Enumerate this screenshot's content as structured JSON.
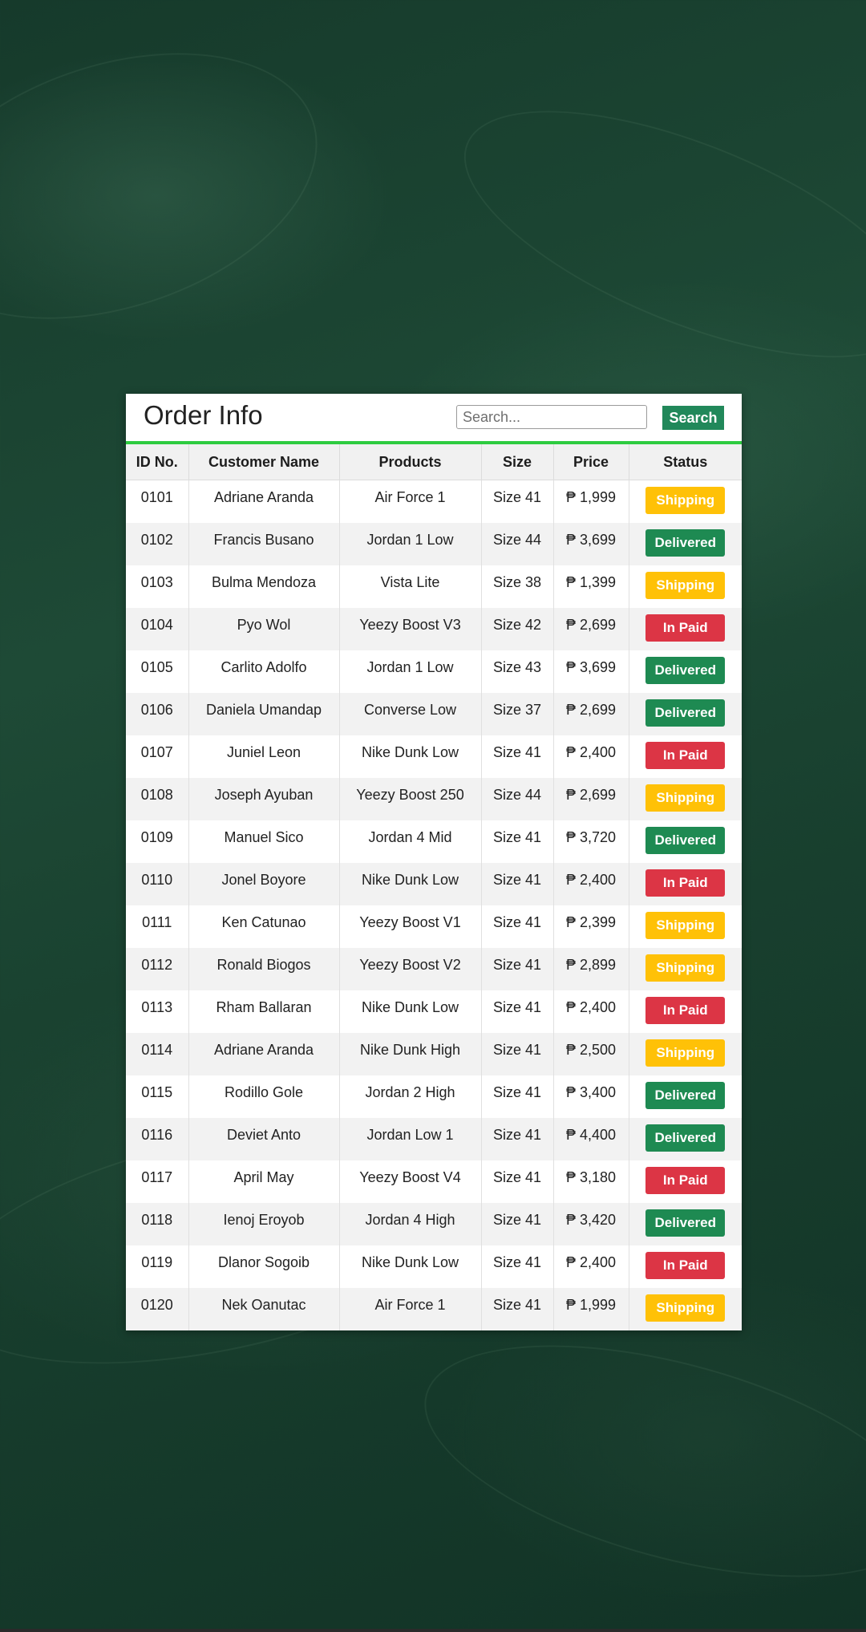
{
  "header": {
    "title": "Order Info",
    "search_placeholder": "Search...",
    "search_button": "Search"
  },
  "table": {
    "columns": [
      "ID No.",
      "Customer Name",
      "Products",
      "Size",
      "Price",
      "Status"
    ],
    "rows": [
      {
        "id": "0101",
        "customer": "Adriane Aranda",
        "product": "Air Force 1",
        "size": "Size 41",
        "price": "₱ 1,999",
        "status": "Shipping"
      },
      {
        "id": "0102",
        "customer": "Francis Busano",
        "product": "Jordan 1 Low",
        "size": "Size 44",
        "price": "₱ 3,699",
        "status": "Delivered"
      },
      {
        "id": "0103",
        "customer": "Bulma Mendoza",
        "product": "Vista Lite",
        "size": "Size 38",
        "price": "₱ 1,399",
        "status": "Shipping"
      },
      {
        "id": "0104",
        "customer": "Pyo Wol",
        "product": "Yeezy Boost V3",
        "size": "Size 42",
        "price": "₱ 2,699",
        "status": "In Paid"
      },
      {
        "id": "0105",
        "customer": "Carlito Adolfo",
        "product": "Jordan 1 Low",
        "size": "Size 43",
        "price": "₱ 3,699",
        "status": "Delivered"
      },
      {
        "id": "0106",
        "customer": "Daniela Umandap",
        "product": "Converse Low",
        "size": "Size 37",
        "price": "₱ 2,699",
        "status": "Delivered"
      },
      {
        "id": "0107",
        "customer": "Juniel Leon",
        "product": "Nike Dunk Low",
        "size": "Size 41",
        "price": "₱ 2,400",
        "status": "In Paid"
      },
      {
        "id": "0108",
        "customer": "Joseph Ayuban",
        "product": "Yeezy Boost 250",
        "size": "Size 44",
        "price": "₱ 2,699",
        "status": "Shipping"
      },
      {
        "id": "0109",
        "customer": "Manuel Sico",
        "product": "Jordan 4 Mid",
        "size": "Size 41",
        "price": "₱ 3,720",
        "status": "Delivered"
      },
      {
        "id": "0110",
        "customer": "Jonel Boyore",
        "product": "Nike Dunk Low",
        "size": "Size 41",
        "price": "₱ 2,400",
        "status": "In Paid"
      },
      {
        "id": "0111",
        "customer": "Ken Catunao",
        "product": "Yeezy Boost V1",
        "size": "Size 41",
        "price": "₱ 2,399",
        "status": "Shipping"
      },
      {
        "id": "0112",
        "customer": "Ronald Biogos",
        "product": "Yeezy Boost V2",
        "size": "Size 41",
        "price": "₱ 2,899",
        "status": "Shipping"
      },
      {
        "id": "0113",
        "customer": "Rham Ballaran",
        "product": "Nike Dunk Low",
        "size": "Size 41",
        "price": "₱ 2,400",
        "status": "In Paid"
      },
      {
        "id": "0114",
        "customer": "Adriane Aranda",
        "product": "Nike Dunk High",
        "size": "Size 41",
        "price": "₱ 2,500",
        "status": "Shipping"
      },
      {
        "id": "0115",
        "customer": "Rodillo Gole",
        "product": "Jordan 2 High",
        "size": "Size 41",
        "price": "₱ 3,400",
        "status": "Delivered"
      },
      {
        "id": "0116",
        "customer": "Deviet Anto",
        "product": "Jordan Low 1",
        "size": "Size 41",
        "price": "₱ 4,400",
        "status": "Delivered"
      },
      {
        "id": "0117",
        "customer": "April May",
        "product": "Yeezy Boost V4",
        "size": "Size 41",
        "price": "₱ 3,180",
        "status": "In Paid"
      },
      {
        "id": "0118",
        "customer": "Ienoj Eroyob",
        "product": "Jordan 4 High",
        "size": "Size 41",
        "price": "₱ 3,420",
        "status": "Delivered"
      },
      {
        "id": "0119",
        "customer": "Dlanor Sogoib",
        "product": "Nike Dunk Low",
        "size": "Size 41",
        "price": "₱ 2,400",
        "status": "In Paid"
      },
      {
        "id": "0120",
        "customer": "Nek Oanutac",
        "product": "Air Force 1",
        "size": "Size 41",
        "price": "₱ 1,999",
        "status": "Shipping"
      }
    ]
  },
  "status_colors": {
    "Shipping": "#ffc107",
    "Delivered": "#1e8a52",
    "In Paid": "#dc3545"
  }
}
